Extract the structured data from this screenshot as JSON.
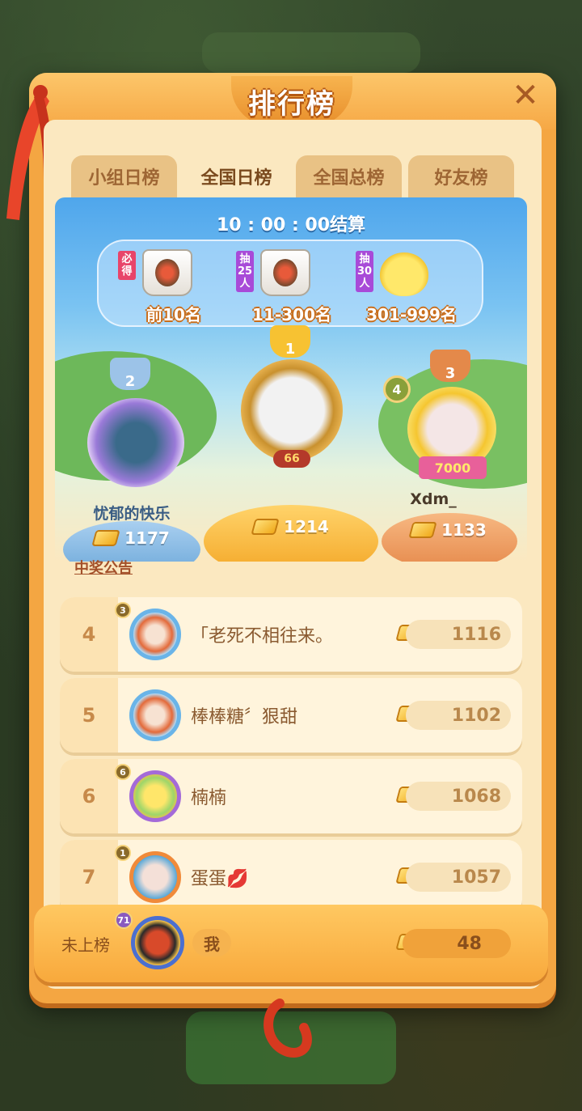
{
  "header": {
    "title": "排行榜",
    "close_icon": "close-icon"
  },
  "tabs": [
    {
      "label": "小组日榜",
      "active": false
    },
    {
      "label": "全国日榜",
      "active": true
    },
    {
      "label": "全国总榜",
      "active": false
    },
    {
      "label": "好友榜",
      "active": false
    }
  ],
  "timer": "10 : 00 : 00结算",
  "prizes": [
    {
      "tag": "必得",
      "tag_color": "#e8456a",
      "label": "前10名",
      "icon": "bag-icon"
    },
    {
      "tag": "抽25人",
      "tag_color": "#a84ad8",
      "label": "11-300名",
      "icon": "bag-icon"
    },
    {
      "tag": "抽30人",
      "tag_color": "#a84ad8",
      "label": "301-999名",
      "icon": "chick-icon"
    }
  ],
  "podium": {
    "first": {
      "rank": "1",
      "score": "1214",
      "badge": "66"
    },
    "second": {
      "rank": "2",
      "name": "忧郁的快乐",
      "score": "1177"
    },
    "third": {
      "rank": "3",
      "name": "Xdm_",
      "score": "1133",
      "level": "4",
      "badge": "7000"
    }
  },
  "notice": "中奖公告",
  "rows": [
    {
      "rank": "4",
      "level": "3",
      "name": "「老死不相往来。",
      "score": "1116"
    },
    {
      "rank": "5",
      "level": "",
      "name": "棒棒糖〞狠甜",
      "score": "1102"
    },
    {
      "rank": "6",
      "level": "6",
      "name": "楠楠",
      "score": "1068"
    },
    {
      "rank": "7",
      "level": "1",
      "name": "蛋蛋💋",
      "score": "1057"
    }
  ],
  "me": {
    "label": "未上榜",
    "level": "71",
    "name": "我",
    "score": "48"
  },
  "colors": {
    "panel": "#f4a642",
    "accent": "#e88e2b",
    "sky": "#4fa6ec"
  }
}
